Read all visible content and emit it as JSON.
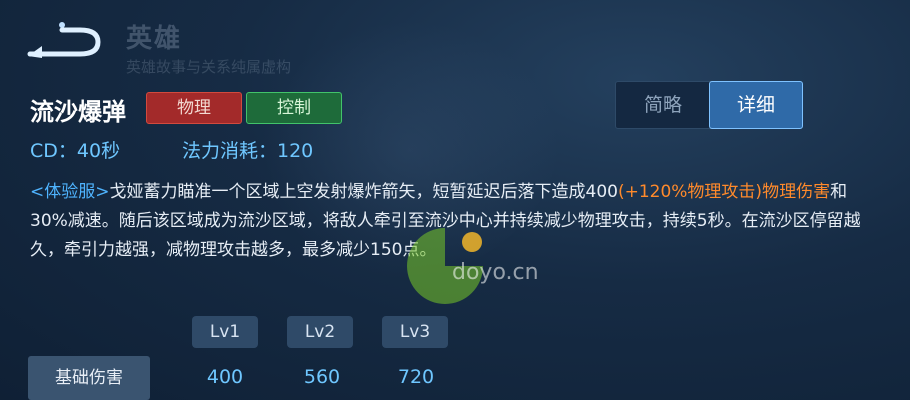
{
  "header": {
    "faded_title": "英雄",
    "faded_subtitle": "英雄故事与关系纯属虚构"
  },
  "skill": {
    "name": "流沙爆弹",
    "tags": [
      "物理",
      "控制"
    ],
    "cd": "CD：40秒",
    "mana": "法力消耗：120"
  },
  "toggle": {
    "brief": "简略",
    "detail": "详细"
  },
  "description": {
    "exp_tag": "<体验服>",
    "part1": "戈娅蓄力瞄准一个区域上空发射爆炸箭矢，短暂延迟后落下造成400",
    "bonus": "(+120%物理攻击)物理伤害",
    "part2": "和30%减速。随后该区域成为流沙区域，将敌人牵引至流沙中心并持续减少物理攻击，持续5秒。在流沙区停留越久，牵引力越强，减物理攻击越多，最多减少150点。"
  },
  "levels": {
    "headers": [
      "Lv1",
      "Lv2",
      "Lv3"
    ],
    "row_label": "基础伤害",
    "values": [
      "400",
      "560",
      "720"
    ]
  },
  "watermark": "doyo.cn",
  "colors": {
    "accent_blue": "#6fc7ff",
    "physical_tag": "#a32a2a",
    "control_tag": "#1e6b3a",
    "bonus_orange": "#ff8a2b"
  }
}
